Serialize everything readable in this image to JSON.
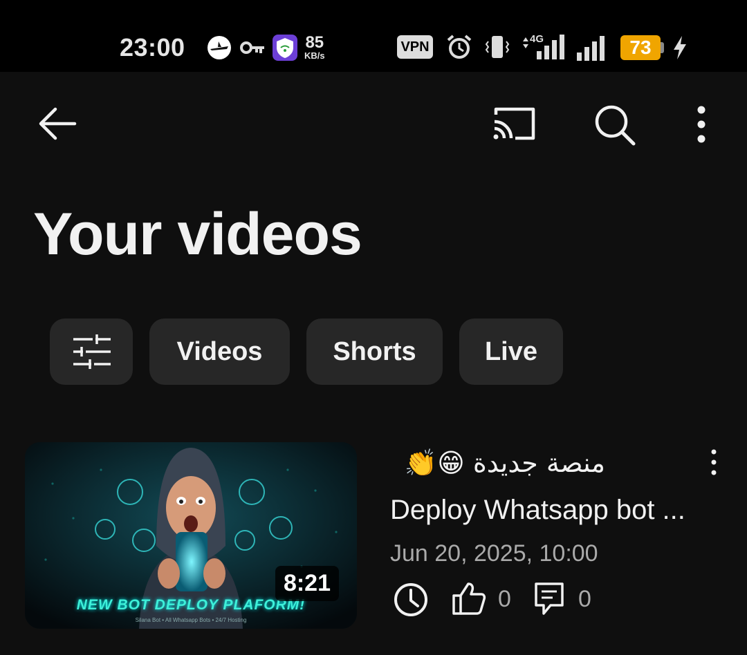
{
  "status_bar": {
    "time": "23:00",
    "net_speed_value": "85",
    "net_speed_unit": "KB/s",
    "vpn_label": "VPN",
    "network_type": "4G",
    "battery_level": "73",
    "battery_color": "#f0a500"
  },
  "top_bar": {
    "back_icon": "arrow-left-icon",
    "cast_icon": "cast-icon",
    "search_icon": "search-icon",
    "more_icon": "more-vert-icon"
  },
  "page": {
    "title": "Your videos"
  },
  "filters": {
    "filter_icon": "sliders-icon",
    "chips": [
      "Videos",
      "Shorts",
      "Live"
    ]
  },
  "video": {
    "title_line1": "منصة جديدة 😁👏",
    "title_line2": "Deploy Whatsapp bot ...",
    "date": "Jun 20, 2025, 10:00",
    "duration": "8:21",
    "thumbnail_caption": "NEW BOT DEPLOY PLAFORM!",
    "thumbnail_subcaption": "Silana Bot • All Whatsapp Bots • 24/7 Hosting",
    "likes": "0",
    "comments": "0"
  }
}
